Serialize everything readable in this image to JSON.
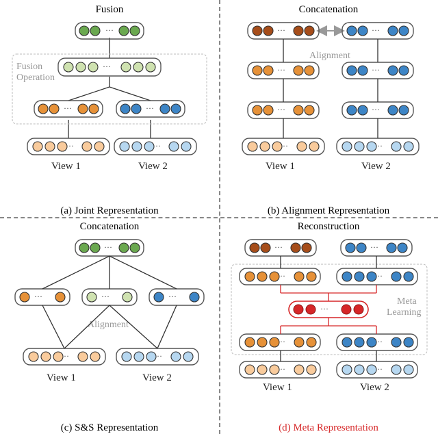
{
  "panels": {
    "a": {
      "title": "Fusion",
      "caption": "(a) Joint Representation",
      "annot": "Fusion\nOperation",
      "v1": "View 1",
      "v2": "View 2"
    },
    "b": {
      "title": "Concatenation",
      "caption": "(b) Alignment Representation",
      "annot": "Alignment",
      "v1": "View 1",
      "v2": "View 2"
    },
    "c": {
      "title": "Concatenation",
      "caption": "(c) S&S Representation",
      "annot": "Alignment",
      "v1": "View 1",
      "v2": "View 2"
    },
    "d": {
      "title": "Reconstruction",
      "caption": "(d) Meta Representation",
      "annot": "Meta\nLearning",
      "v1": "View 1",
      "v2": "View 2"
    }
  },
  "colors": {
    "green": "#6aa84f",
    "green_l": "#cfe2b0",
    "orange": "#e69138",
    "orange_l": "#f9cb9c",
    "blue": "#3d85c6",
    "blue_l": "#b6d7f0",
    "brown": "#a64d1a",
    "red": "#d62728"
  },
  "chart_data": {
    "type": "diagram",
    "panels": [
      {
        "id": "a",
        "name": "Joint Representation",
        "top_op": "Fusion",
        "region_label": "Fusion Operation",
        "rows": [
          {
            "layers": [
              {
                "color": "green",
                "role": "fusion-output"
              }
            ]
          },
          {
            "layers": [
              {
                "color": "green_l",
                "role": "fusion-op-wide"
              }
            ],
            "boxed": true
          },
          {
            "layers": [
              {
                "color": "orange",
                "role": "view1-enc"
              },
              {
                "color": "blue",
                "role": "view2-enc"
              }
            ],
            "boxed": true
          },
          {
            "layers": [
              {
                "color": "orange_l",
                "role": "view1-input"
              },
              {
                "color": "blue_l",
                "role": "view2-input"
              }
            ]
          }
        ],
        "edges": [
          "top->fusion",
          "fusion->v1enc",
          "fusion->v2enc",
          "v1enc->v1in",
          "v2enc->v2in"
        ]
      },
      {
        "id": "b",
        "name": "Alignment Representation",
        "top_op": "Concatenation",
        "region_label": "Alignment",
        "alignment_arrow": "bidirectional",
        "rows": [
          {
            "layers": [
              {
                "color": "brown",
                "role": "concat-left"
              },
              {
                "color": "blue",
                "role": "concat-right"
              }
            ]
          },
          {
            "layers": [
              {
                "color": "orange",
                "role": "v1-l3"
              },
              {
                "color": "blue",
                "role": "v2-l3"
              }
            ]
          },
          {
            "layers": [
              {
                "color": "orange",
                "role": "v1-l2"
              },
              {
                "color": "blue",
                "role": "v2-l2"
              }
            ]
          },
          {
            "layers": [
              {
                "color": "orange_l",
                "role": "view1-input"
              },
              {
                "color": "blue_l",
                "role": "view2-input"
              }
            ]
          }
        ],
        "edges": [
          "column-stack-each-view"
        ]
      },
      {
        "id": "c",
        "name": "S&S Representation",
        "top_op": "Concatenation",
        "region_label": "Alignment",
        "rows": [
          {
            "layers": [
              {
                "color": "green",
                "role": "concat-output"
              }
            ]
          },
          {
            "layers": [
              {
                "color": "orange",
                "role": "spec1"
              },
              {
                "color": "green_l",
                "role": "shared"
              },
              {
                "color": "blue",
                "role": "spec2"
              }
            ]
          },
          {
            "layers": [
              {
                "color": "orange_l",
                "role": "view1-input"
              },
              {
                "color": "blue_l",
                "role": "view2-input"
              }
            ]
          }
        ],
        "edges": [
          "top->spec1",
          "top->shared",
          "top->spec2",
          "spec1->v1in",
          "shared->v1in",
          "shared->v2in",
          "spec2->v2in"
        ]
      },
      {
        "id": "d",
        "name": "Meta Representation",
        "top_op": "Reconstruction",
        "region_label": "Meta Learning",
        "rows": [
          {
            "layers": [
              {
                "color": "brown",
                "role": "recon-v1"
              },
              {
                "color": "blue",
                "role": "recon-v2"
              }
            ]
          },
          {
            "layers": [
              {
                "color": "orange",
                "role": "enc-v1"
              },
              {
                "color": "blue",
                "role": "enc-v2"
              }
            ],
            "boxed": true
          },
          {
            "layers": [
              {
                "color": "red",
                "role": "meta"
              }
            ],
            "boxed": true
          },
          {
            "layers": [
              {
                "color": "orange",
                "role": "dec-v1"
              },
              {
                "color": "blue",
                "role": "dec-v2"
              }
            ],
            "boxed": true
          },
          {
            "layers": [
              {
                "color": "orange_l",
                "role": "view1-input"
              },
              {
                "color": "blue_l",
                "role": "view2-input"
              }
            ]
          }
        ],
        "edges": [
          "stacked per view + meta bottleneck (red)"
        ]
      }
    ]
  }
}
